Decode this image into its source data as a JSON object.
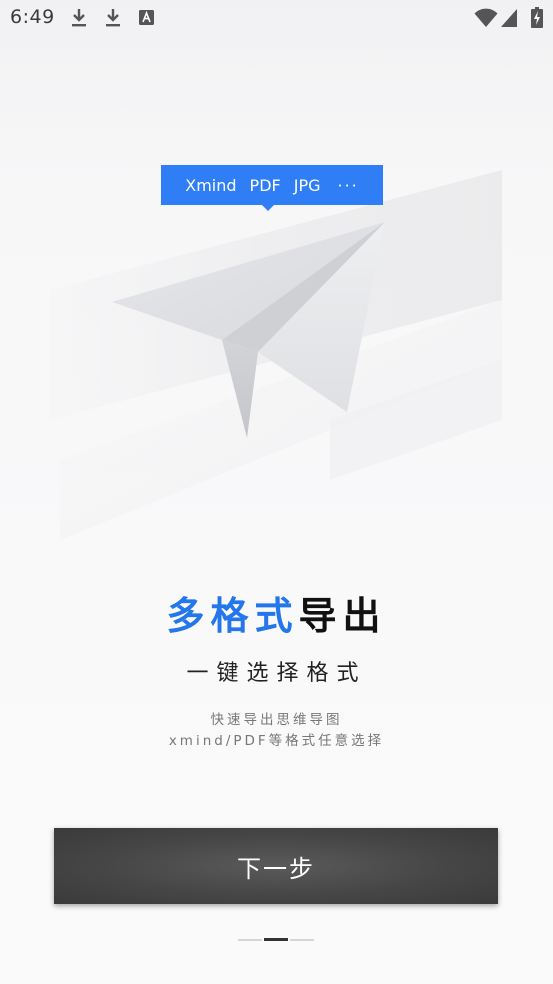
{
  "status_bar": {
    "time": "6:49",
    "left_icons": [
      "download-icon",
      "download-icon",
      "text-input-icon"
    ],
    "right_icons": [
      "wifi-icon",
      "cellular-signal-icon",
      "battery-charging-icon"
    ]
  },
  "format_tip": {
    "items": [
      "Xmind",
      "PDF",
      "JPG"
    ],
    "more": "···",
    "color": "#2f7ef6"
  },
  "headline": {
    "accent": "多格式",
    "plain": "导出",
    "accent_color": "#2377ea"
  },
  "subheadline": "一键选择格式",
  "description": {
    "line1": "快速导出思维导图",
    "line2": "xmind/PDF等格式任意选择"
  },
  "next_button": {
    "label": "下一步"
  },
  "page_indicator": {
    "total": 3,
    "current": 2
  }
}
